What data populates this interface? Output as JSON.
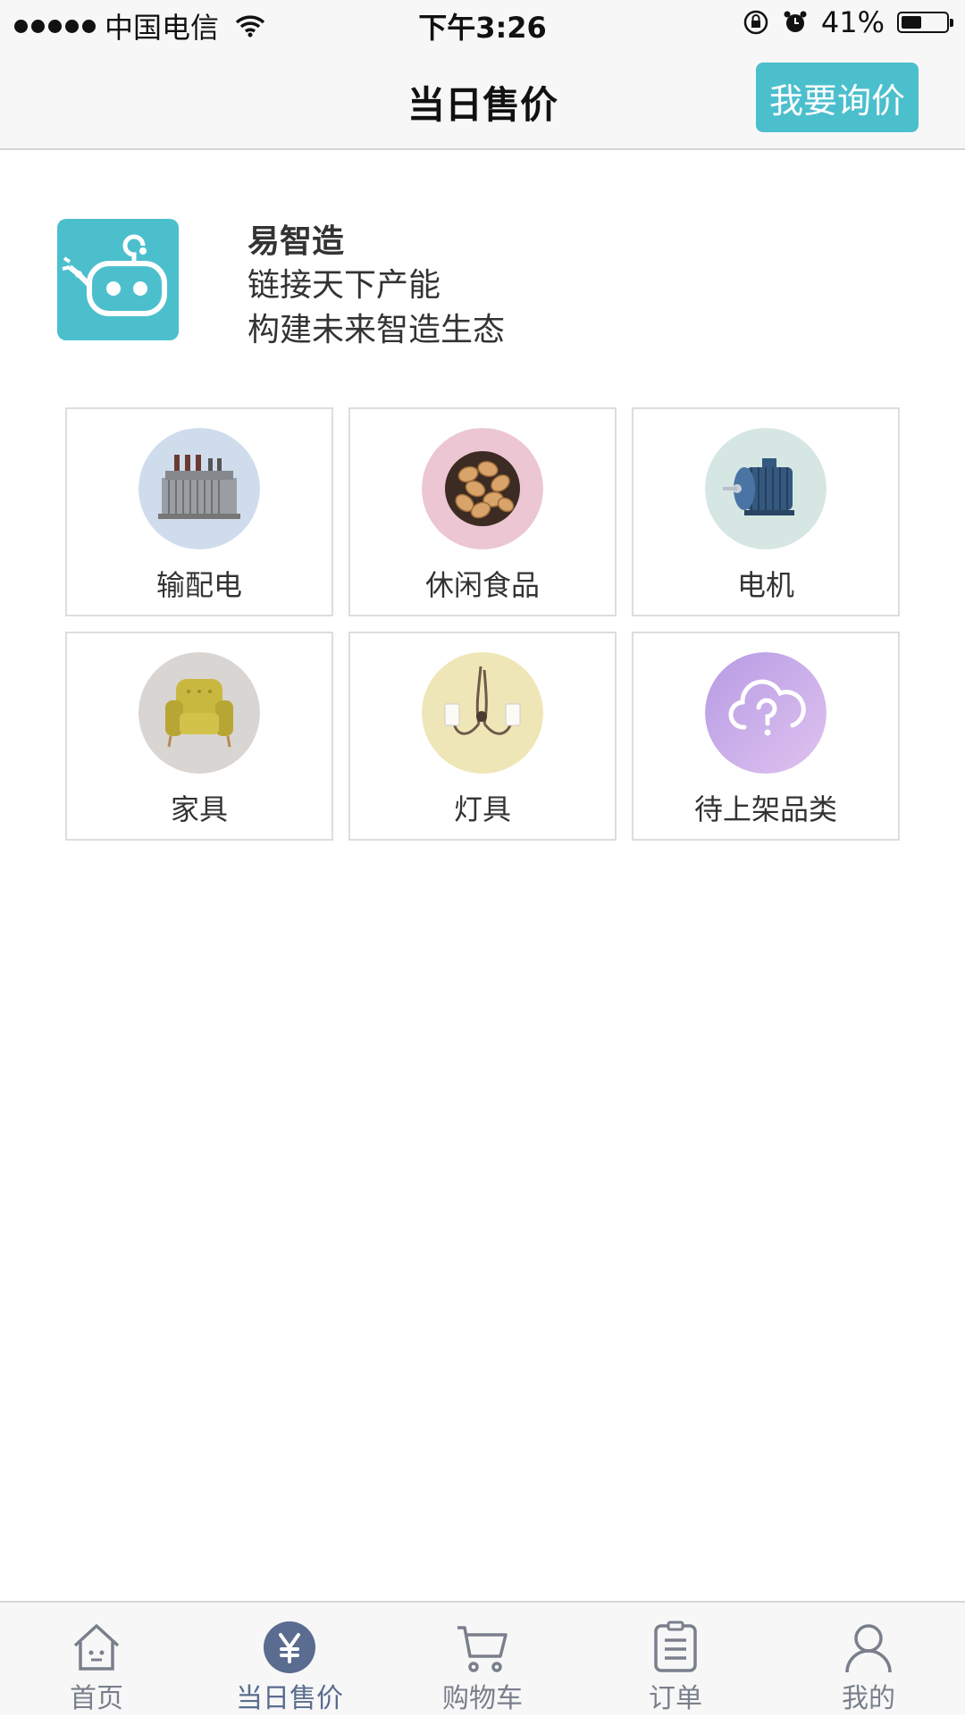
{
  "status_bar": {
    "carrier": "中国电信",
    "time": "下午3:26",
    "battery": "41%",
    "battery_level": 0.41
  },
  "nav": {
    "title": "当日售价",
    "inquiry_button": "我要询价"
  },
  "brand": {
    "name": "易智造",
    "slogan_line1": "链接天下产能",
    "slogan_line2": "构建未来智造生态"
  },
  "categories": [
    {
      "label": "输配电",
      "icon": "transformer-icon"
    },
    {
      "label": "休闲食品",
      "icon": "nuts-icon"
    },
    {
      "label": "电机",
      "icon": "motor-icon"
    },
    {
      "label": "家具",
      "icon": "armchair-icon"
    },
    {
      "label": "灯具",
      "icon": "lamp-icon"
    },
    {
      "label": "待上架品类",
      "icon": "cloud-question-icon"
    }
  ],
  "tabs": [
    {
      "label": "首页",
      "icon": "home-icon"
    },
    {
      "label": "当日售价",
      "icon": "yuan-icon",
      "active": true
    },
    {
      "label": "购物车",
      "icon": "cart-icon"
    },
    {
      "label": "订单",
      "icon": "order-list-icon"
    },
    {
      "label": "我的",
      "icon": "user-icon"
    }
  ],
  "colors": {
    "accent": "#4cbfcd",
    "tab_active": "#5a6c8f",
    "tab_inactive": "#7a7f8c"
  }
}
